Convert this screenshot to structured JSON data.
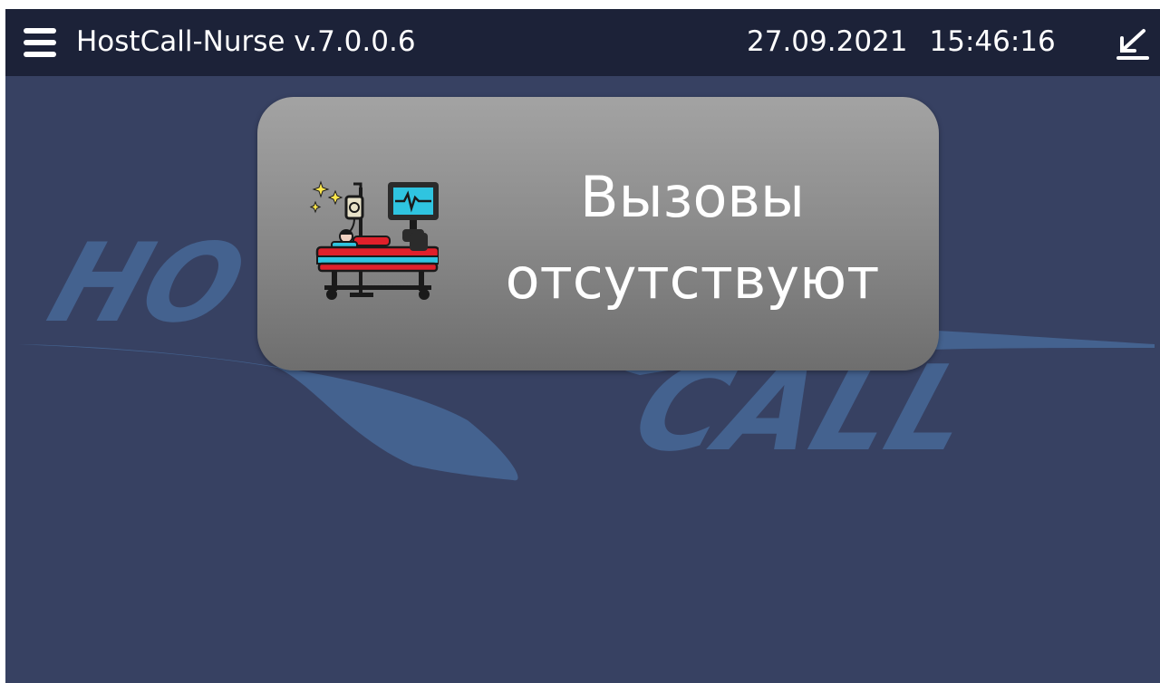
{
  "header": {
    "title": "HostCall-Nurse v.7.0.0.6",
    "date": "27.09.2021",
    "time": "15:46:16",
    "menu_icon": "hamburger-menu-icon",
    "minimize_icon": "minimize-arrow-icon"
  },
  "background": {
    "logo_text_top": "HO",
    "logo_text_bottom": "CALL"
  },
  "status": {
    "line1": "Вызовы",
    "line2": "отсутствуют",
    "icon": "patient-bed-monitor-icon"
  },
  "colors": {
    "topbar": "#1c2238",
    "background": "#374162",
    "logo": "#44628f",
    "card_top": "#a3a3a3",
    "card_bottom": "#6e6e6e",
    "text": "#ffffff"
  }
}
